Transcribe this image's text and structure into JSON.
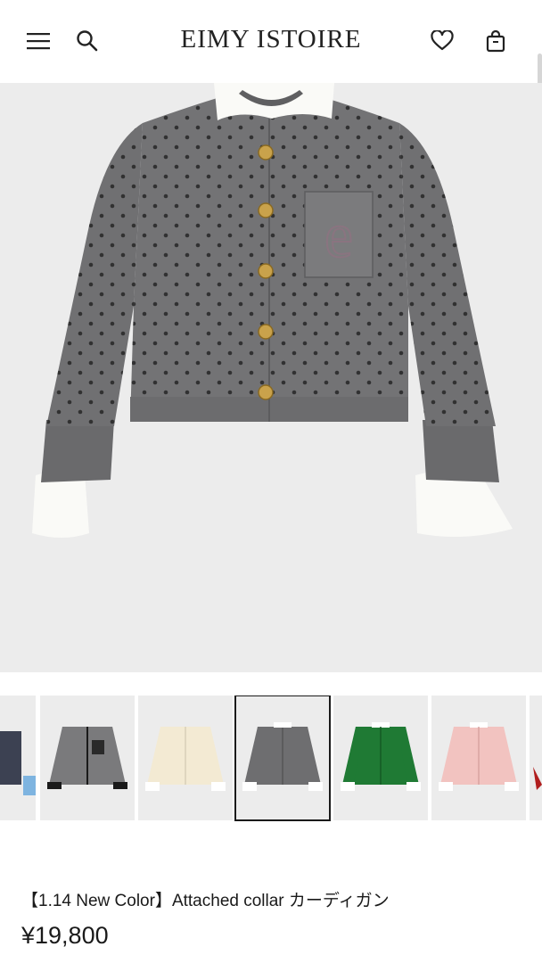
{
  "header": {
    "brand": "EIMY ISTOIRE",
    "menu_icon": "menu-icon",
    "search_icon": "search-icon",
    "favorite_icon": "heart-icon",
    "cart_icon": "shopping-bag-icon"
  },
  "product": {
    "title": "【1.14 New Color】Attached collar カーディガン",
    "price": "¥19,800",
    "hero_color": "#6f6f70"
  },
  "thumbnails": [
    {
      "color_name": "navy-partial",
      "body": "#3c4152",
      "selected": false
    },
    {
      "color_name": "gray-black-trim",
      "body": "#7a7a7c",
      "selected": false
    },
    {
      "color_name": "ivory",
      "body": "#f3ead3",
      "selected": false
    },
    {
      "color_name": "gray",
      "body": "#6e6e70",
      "selected": true
    },
    {
      "color_name": "green",
      "body": "#1f7a34",
      "selected": false
    },
    {
      "color_name": "pink",
      "body": "#f2c3c0",
      "selected": false
    },
    {
      "color_name": "red-partial",
      "body": "#b01e1e",
      "selected": false
    }
  ],
  "colors": {
    "background": "#ffffff",
    "image_bg": "#ececec",
    "text": "#1a1a1a"
  }
}
